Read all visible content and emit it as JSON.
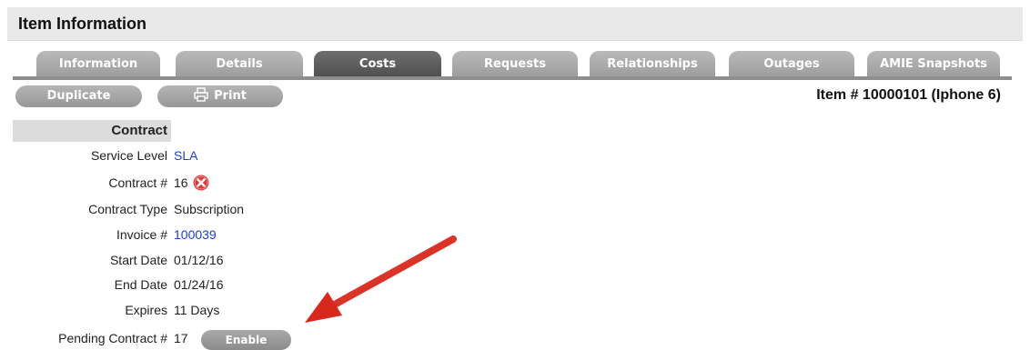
{
  "header": {
    "title": "Item Information"
  },
  "tabs": [
    {
      "label": "Information",
      "active": false
    },
    {
      "label": "Details",
      "active": false
    },
    {
      "label": "Costs",
      "active": true
    },
    {
      "label": "Requests",
      "active": false
    },
    {
      "label": "Relationships",
      "active": false
    },
    {
      "label": "Outages",
      "active": false
    },
    {
      "label": "AMIE Snapshots",
      "active": false
    }
  ],
  "toolbar": {
    "duplicate_label": "Duplicate",
    "print_label": "Print",
    "print_icon": "printer-icon"
  },
  "item_number": "Item # 10000101 (Iphone 6)",
  "contract": {
    "section_title": "Contract",
    "service_level_label": "Service Level",
    "service_level_value": "SLA",
    "contract_no_label": "Contract #",
    "contract_no_value": "16",
    "remove_icon": "remove-icon",
    "contract_type_label": "Contract Type",
    "contract_type_value": "Subscription",
    "invoice_label": "Invoice #",
    "invoice_value": "100039",
    "start_date_label": "Start Date",
    "start_date_value": "01/12/16",
    "end_date_label": "End Date",
    "end_date_value": "01/24/16",
    "expires_label": "Expires",
    "expires_value": "11 Days",
    "pending_label": "Pending Contract #",
    "pending_value": "17",
    "enable_label": "Enable"
  },
  "colors": {
    "link": "#1a3fcc",
    "arrow": "#d8281e",
    "active_tab": "#5a5a5a",
    "inactive_tab": "#a8a8a8"
  }
}
